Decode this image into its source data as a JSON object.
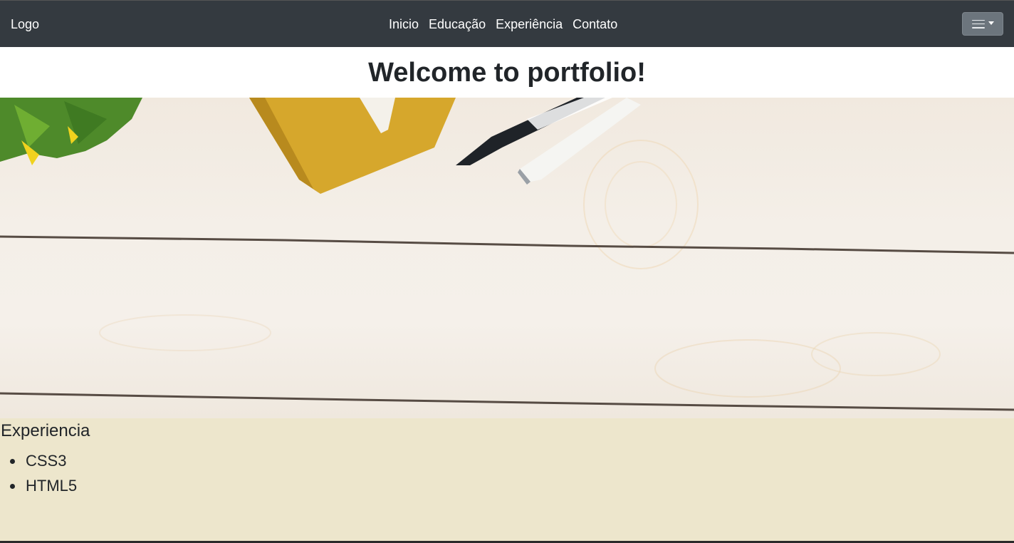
{
  "navbar": {
    "brand": "Logo",
    "links": [
      "Inicio",
      "Educação",
      "Experiência",
      "Contato"
    ],
    "toggler_icon": "menu-icon"
  },
  "welcome": {
    "title": "Welcome to portfolio!"
  },
  "hero": {
    "image_alt": "wooden desk with notebook, fountain pen and plant"
  },
  "experience": {
    "heading": "Experiencia",
    "items": [
      "CSS3",
      "HTML5"
    ]
  },
  "colors": {
    "navbar_bg": "#343a40",
    "toggler_bg": "#6c757d",
    "section_bg": "#ede6cc",
    "notebook": "#d6a72c"
  }
}
